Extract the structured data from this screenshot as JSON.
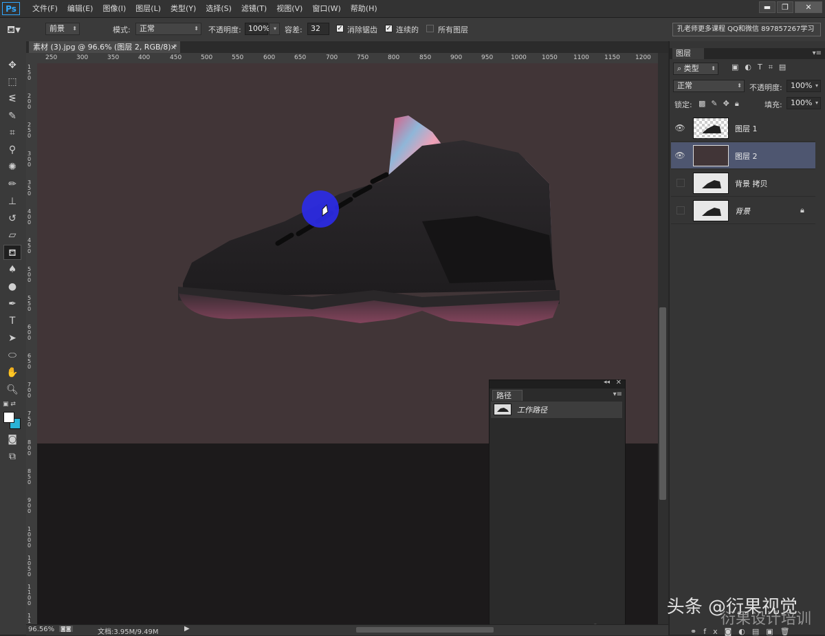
{
  "app": {
    "logo": "Ps"
  },
  "menu": [
    "文件(F)",
    "编辑(E)",
    "图像(I)",
    "图层(L)",
    "类型(Y)",
    "选择(S)",
    "滤镜(T)",
    "视图(V)",
    "窗口(W)",
    "帮助(H)"
  ],
  "window_controls": {
    "minimize": "▬",
    "restore": "❐",
    "close": "✕"
  },
  "options": {
    "fill_source": "前景",
    "mode_label": "模式:",
    "mode_value": "正常",
    "opacity_label": "不透明度:",
    "opacity_value": "100%",
    "tolerance_label": "容差:",
    "tolerance_value": "32",
    "antialias_label": "消除锯齿",
    "contiguous_label": "连续的",
    "all_layers_label": "所有图层",
    "promo": "孔老师更多课程 QQ和微信 897857267学习"
  },
  "document": {
    "tab_title": "素材 (3).jpg @ 96.6% (图层 2, RGB/8) *",
    "tab_close": "×",
    "ruler_ticks": [
      "250",
      "300",
      "350",
      "400",
      "450",
      "500",
      "550",
      "600",
      "650",
      "700",
      "750",
      "800",
      "850",
      "900",
      "950",
      "1000",
      "1050",
      "1100",
      "1150",
      "1200"
    ],
    "vruler_ticks": [
      "1 5 0",
      "2 0 0",
      "2 5 0",
      "3 0 0",
      "3 5 0",
      "4 0 0",
      "4 5 0",
      "5 0 0",
      "5 5 0",
      "6 0 0",
      "6 5 0",
      "7 0 0",
      "7 5 0",
      "8 0 0",
      "8 5 0",
      "9 0 0",
      "1 0 0 0",
      "1 0 5 0",
      "1 1 0 0",
      "1 1 5 0"
    ]
  },
  "status": {
    "zoom": "96.56%",
    "doc_info": "文档:3.95M/9.49M"
  },
  "paths_panel": {
    "tab": "路径",
    "items": [
      {
        "name": "工作路径"
      }
    ]
  },
  "layers_panel": {
    "tab": "图层",
    "filter_kind": "类型",
    "blend_mode": "正常",
    "opacity_label": "不透明度:",
    "opacity_value": "100%",
    "lock_label": "锁定:",
    "fill_label": "填充:",
    "fill_value": "100%",
    "layers": [
      {
        "name": "图层 1",
        "visible": true,
        "selected": false
      },
      {
        "name": "图层 2",
        "visible": true,
        "selected": true
      },
      {
        "name": "背景 拷贝",
        "visible": false,
        "selected": false
      },
      {
        "name": "背景",
        "visible": false,
        "selected": false,
        "locked": true
      }
    ]
  },
  "watermark": {
    "line1": "头条 @衍果视觉",
    "line2": "衍果设计培训"
  },
  "colors": {
    "canvas": "#413537",
    "selected_layer": "#4e5670",
    "brush_cursor": "#2b2be6",
    "background_swatch": "#2ab3d6"
  }
}
